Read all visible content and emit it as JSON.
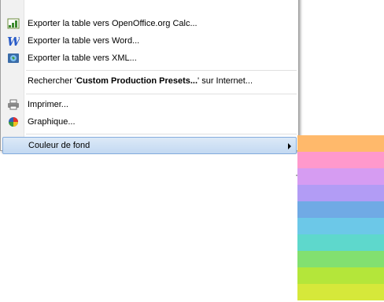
{
  "context_menu": {
    "items": [
      {
        "icon": "calc-spreadsheet-icon",
        "label": "Exporter la table vers OpenOffice.org Calc..."
      },
      {
        "icon": "word-document-icon",
        "label": "Exporter la table vers Word..."
      },
      {
        "icon": "xml-globe-icon",
        "label": "Exporter la table vers XML..."
      },
      {
        "search_prefix": "Rechercher '",
        "search_term": "Custom Production Presets...",
        "search_suffix": "' sur Internet..."
      },
      {
        "icon": "printer-icon",
        "label": "Imprimer..."
      },
      {
        "icon": "pie-chart-icon",
        "label": "Graphique..."
      },
      {
        "label": "Couleur de fond",
        "has_submenu": true,
        "selected": true
      }
    ]
  },
  "color_submenu": {
    "swatches": [
      {
        "name": "orange",
        "color": "#ffb96b"
      },
      {
        "name": "pink",
        "color": "#ff99cc"
      },
      {
        "name": "violet",
        "color": "#d69cf2"
      },
      {
        "name": "lavender",
        "color": "#b29cf5"
      },
      {
        "name": "blue",
        "color": "#70aae5"
      },
      {
        "name": "sky-blue",
        "color": "#6cc8e8"
      },
      {
        "name": "turquoise",
        "color": "#5ed8cc"
      },
      {
        "name": "green",
        "color": "#82e070"
      },
      {
        "name": "lime",
        "color": "#b4e63a"
      },
      {
        "name": "yellow-green",
        "color": "#d6e83a"
      }
    ]
  }
}
